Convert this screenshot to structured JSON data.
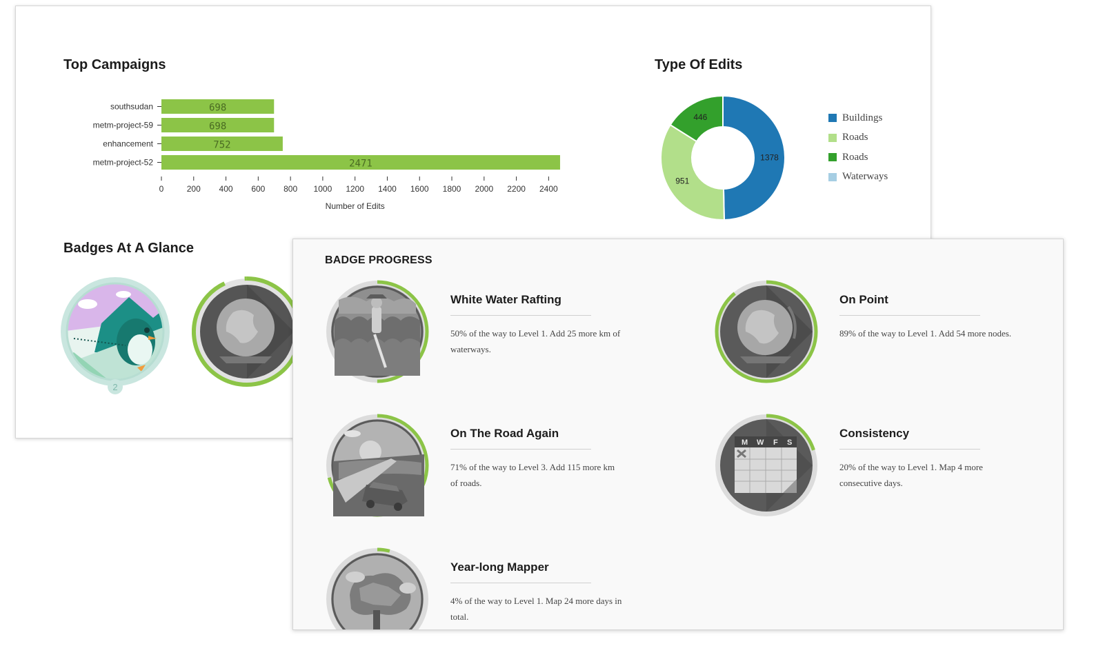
{
  "campaigns": {
    "title": "Top Campaigns",
    "chart_data": {
      "type": "bar",
      "orientation": "horizontal",
      "categories": [
        "southsudan",
        "metm-project-59",
        "enhancement",
        "metm-project-52"
      ],
      "values": [
        698,
        698,
        752,
        2471
      ],
      "xlabel": "Number of Edits",
      "ylabel": "",
      "xlim": [
        0,
        2471
      ],
      "xticks": [
        0,
        200,
        400,
        600,
        800,
        1000,
        1200,
        1400,
        1600,
        1800,
        2000,
        2200,
        2400
      ],
      "bar_color": "#8cc447",
      "grid": false
    }
  },
  "edits": {
    "title": "Type Of Edits",
    "chart_data": {
      "type": "pie",
      "donut": true,
      "slices": [
        {
          "name": "Buildings",
          "value": 1378,
          "color": "#1f78b4"
        },
        {
          "name": "Roads",
          "value": 951,
          "color": "#b2df8a"
        },
        {
          "name": "Roads",
          "value": 446,
          "color": "#33a02c"
        }
      ],
      "legend": [
        {
          "label": "Buildings",
          "color": "#1f78b4"
        },
        {
          "label": "Roads",
          "color": "#b2df8a"
        },
        {
          "label": "Roads",
          "color": "#33a02c"
        },
        {
          "label": "Waterways",
          "color": "#a6cee3"
        }
      ],
      "legend_position": "right"
    }
  },
  "glance": {
    "title": "Badges At A Glance",
    "badges": [
      {
        "icon": "narwhal-badge-icon",
        "level": "2"
      },
      {
        "icon": "globe-badge-icon"
      }
    ]
  },
  "progress": {
    "heading": "BADGE PROGRESS",
    "accent_color": "#8cc447",
    "badges": [
      {
        "name": "White Water Rafting",
        "desc": "50% of the way to Level 1. Add 25 more km of waterways.",
        "progress": 0.5,
        "icon": "rafting-icon"
      },
      {
        "name": "On Point",
        "desc": "89% of the way to Level 1. Add 54 more nodes.",
        "progress": 0.89,
        "icon": "globe-icon"
      },
      {
        "name": "On The Road Again",
        "desc": "71% of the way to Level 3. Add 115 more km of roads.",
        "progress": 0.71,
        "icon": "car-road-icon"
      },
      {
        "name": "Consistency",
        "desc": "20% of the way to Level 1. Map 4 more consecutive days.",
        "progress": 0.2,
        "icon": "calendar-icon",
        "calendar_days": [
          "M",
          "W",
          "F",
          "S"
        ]
      },
      {
        "name": "Year-long Mapper",
        "desc": "4% of the way to Level 1. Map 24 more days in total.",
        "progress": 0.04,
        "icon": "tree-map-icon"
      }
    ]
  }
}
